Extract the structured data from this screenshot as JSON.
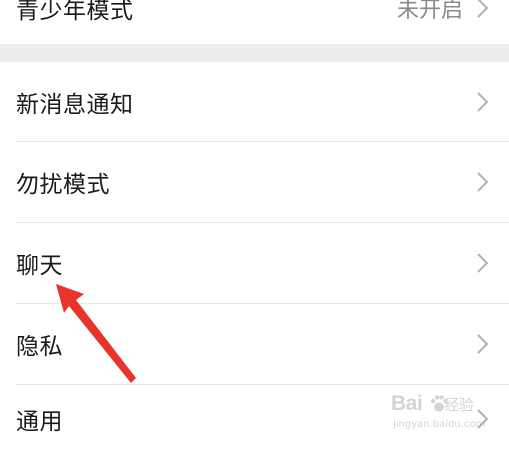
{
  "settings": {
    "youth_mode": {
      "label": "青少年模式",
      "value": "未开启"
    },
    "items": [
      {
        "label": "新消息通知"
      },
      {
        "label": "勿扰模式"
      },
      {
        "label": "聊天"
      },
      {
        "label": "隐私"
      },
      {
        "label": "通用"
      }
    ]
  },
  "watermark": {
    "brand": "Bai",
    "brand_suffix": "经验",
    "url": "jingyan.baidu.com"
  },
  "colors": {
    "background": "#ffffff",
    "section_gap": "#ededed",
    "text": "#1a1a1a",
    "secondary_text": "#8a8a8a",
    "chevron": "#b2b2b2",
    "arrow": "#e8342a"
  },
  "icons": {
    "chevron": "chevron-right-icon",
    "annotation": "red-arrow-annotation"
  }
}
